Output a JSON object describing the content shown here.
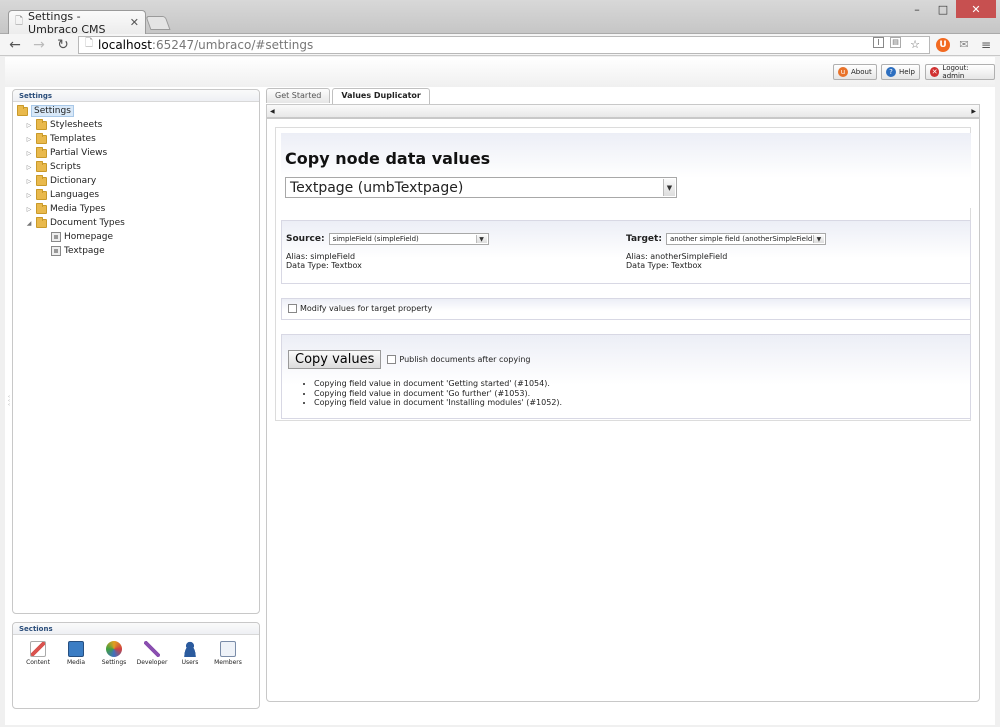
{
  "browser": {
    "tab_title": "Settings - Umbraco CMS",
    "url_host": "localhost",
    "url_path": ":65247/umbraco/#settings",
    "window_minimize": "–",
    "window_maximize": "□",
    "window_close": "✕"
  },
  "topbar": {
    "about": "About",
    "help": "Help",
    "logout": "Logout: admin"
  },
  "settings_panel": {
    "header": "Settings",
    "root": "Settings",
    "items": [
      {
        "label": "Stylesheets"
      },
      {
        "label": "Templates"
      },
      {
        "label": "Partial Views"
      },
      {
        "label": "Scripts"
      },
      {
        "label": "Dictionary"
      },
      {
        "label": "Languages"
      },
      {
        "label": "Media Types"
      },
      {
        "label": "Document Types"
      }
    ],
    "document_types_children": [
      {
        "label": "Homepage"
      },
      {
        "label": "Textpage"
      }
    ]
  },
  "sections_panel": {
    "header": "Sections",
    "items": [
      {
        "label": "Content",
        "color": "#d9534f"
      },
      {
        "label": "Media",
        "color": "#3b7dc4"
      },
      {
        "label": "Settings",
        "color": "#e0a020"
      },
      {
        "label": "Developer",
        "color": "#8a4fb0"
      },
      {
        "label": "Users",
        "color": "#2b5b9e"
      },
      {
        "label": "Members",
        "color": "#7a8ca8"
      }
    ]
  },
  "tabs": [
    {
      "label": "Get Started"
    },
    {
      "label": "Values Duplicator"
    }
  ],
  "main": {
    "title": "Copy node data values",
    "doctype_selected": "Textpage (umbTextpage)",
    "source_label": "Source:",
    "source_selected": "simpleField (simpleField)",
    "source_alias": "Alias: simpleField",
    "source_datatype": "Data Type: Textbox",
    "target_label": "Target:",
    "target_selected": "another simple field (anotherSimpleField)",
    "target_alias": "Alias: anotherSimpleField",
    "target_datatype": "Data Type: Textbox",
    "modify_label": "Modify values for target property",
    "copy_button": "Copy values",
    "publish_label": "Publish documents after copying",
    "log": [
      "Copying field value in document 'Getting started' (#1054).",
      "Copying field value in document 'Go further' (#1053).",
      "Copying field value in document 'Installing modules' (#1052)."
    ]
  }
}
